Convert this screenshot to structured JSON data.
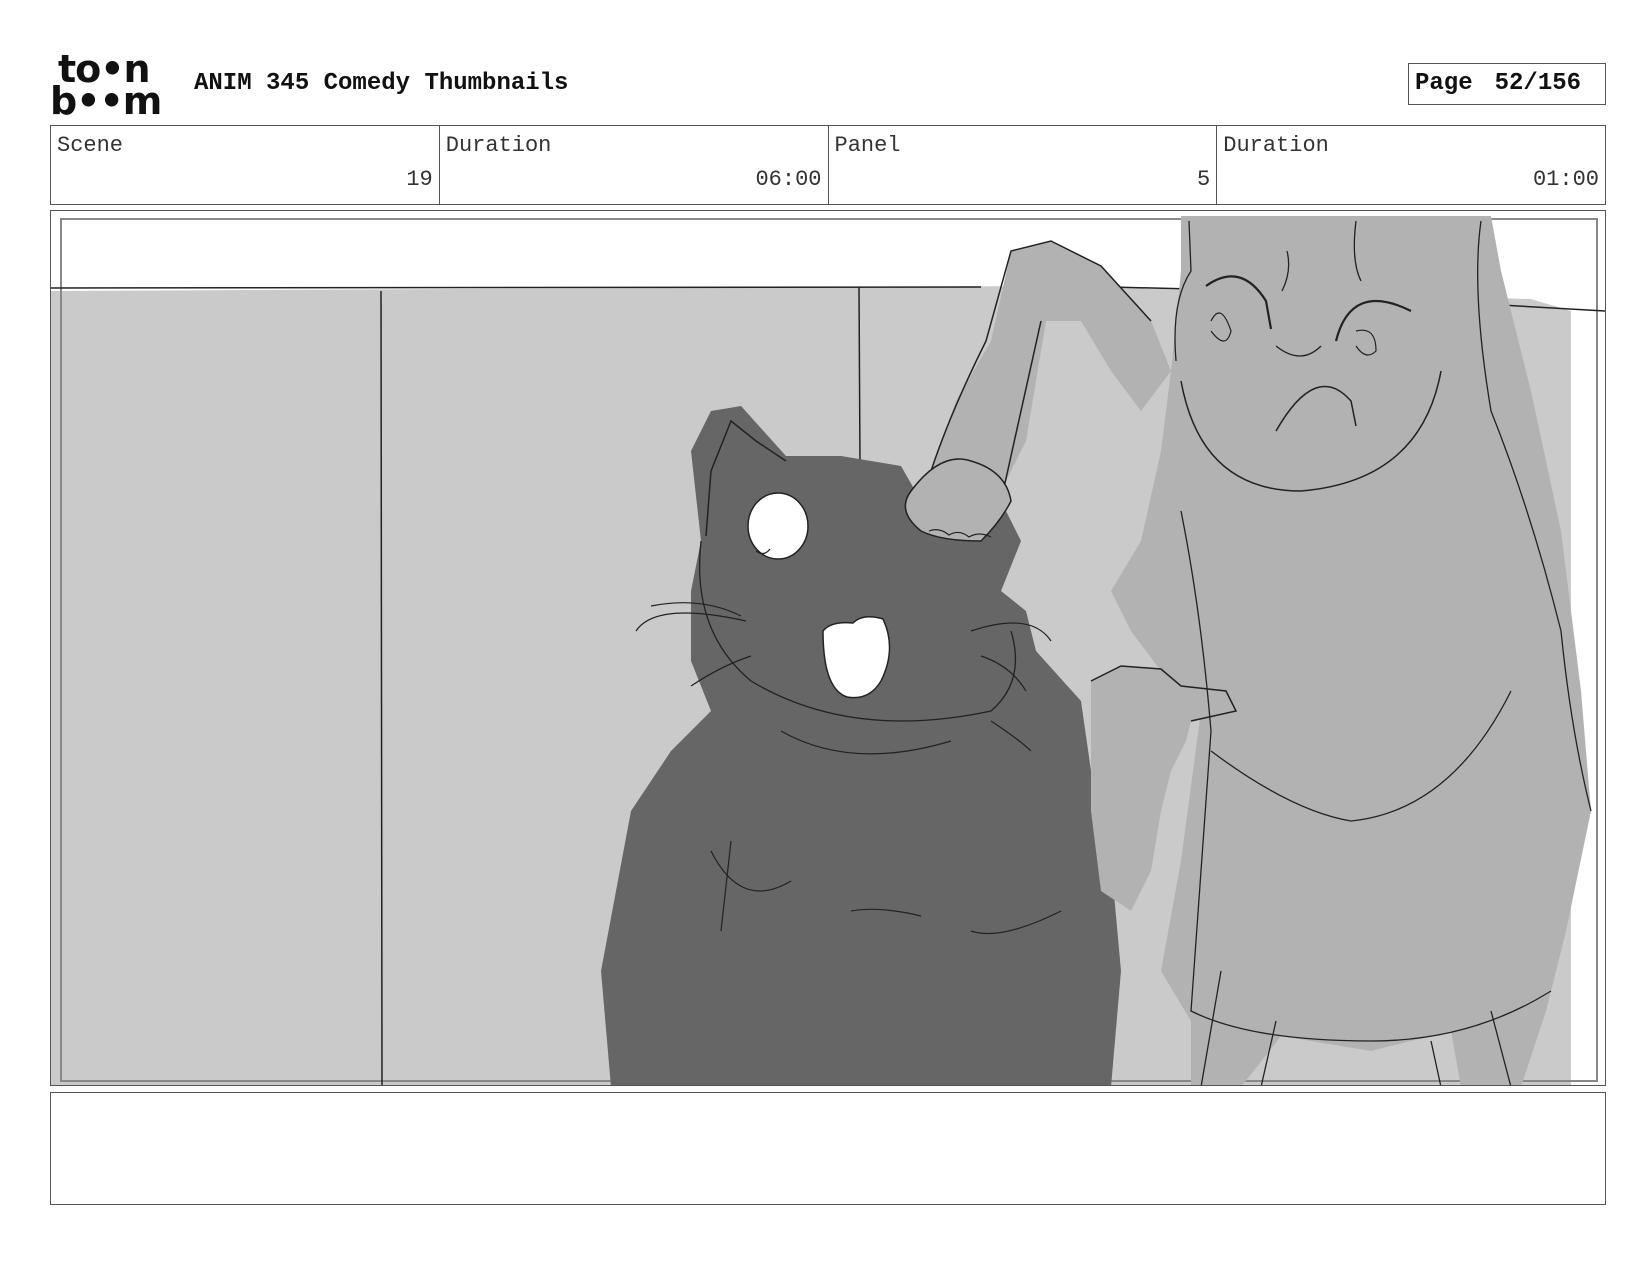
{
  "header": {
    "logo_top": "to•n",
    "logo_bottom": "b••m",
    "title": "ANIM 345 Comedy Thumbnails",
    "page_label": "Page",
    "page_value": "52/156"
  },
  "info": {
    "scene_label": "Scene",
    "scene_value": "19",
    "scene_duration_label": "Duration",
    "scene_duration_value": "06:00",
    "panel_label": "Panel",
    "panel_value": "5",
    "panel_duration_label": "Duration",
    "panel_duration_value": "01:00"
  },
  "panel": {
    "colors": {
      "wall": "#cacaca",
      "cat": "#666666",
      "girl": "#b2b2b2",
      "line": "#222222"
    }
  },
  "notes": {
    "text": ""
  }
}
